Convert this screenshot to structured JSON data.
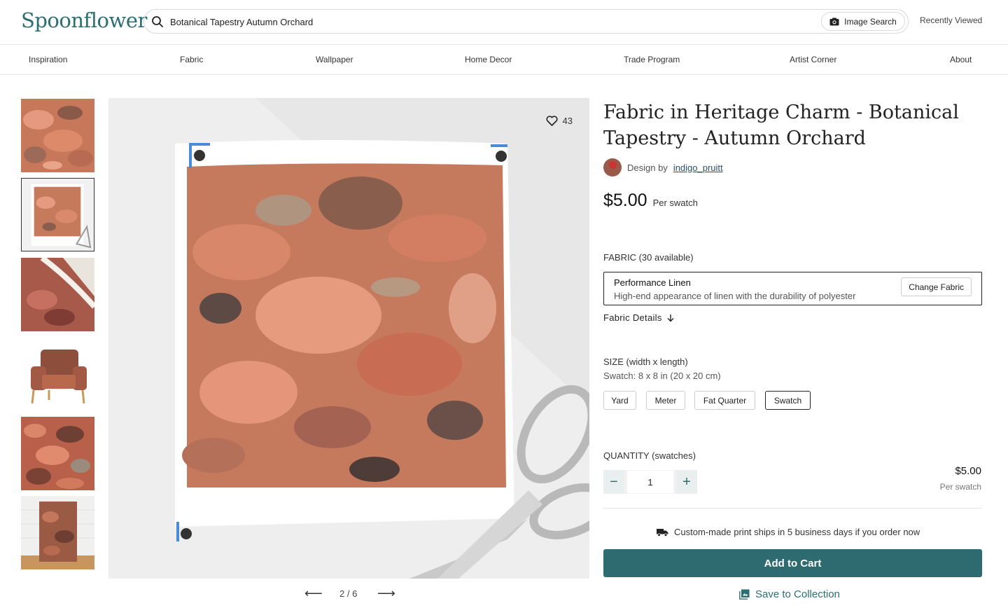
{
  "header": {
    "logo": "Spoonflower",
    "search_value": "Botanical Tapestry Autumn Orchard",
    "image_search_label": "Image Search",
    "recently_viewed": "Recently Viewed"
  },
  "nav": [
    "Inspiration",
    "Fabric",
    "Wallpaper",
    "Home Decor",
    "Trade Program",
    "Artist Corner",
    "About"
  ],
  "gallery": {
    "favorites_count": "43",
    "pager": "2 / 6",
    "prev_icon": "arrow-left-icon",
    "next_icon": "arrow-right-icon"
  },
  "product": {
    "title": "Fabric in Heritage Charm - Botanical Tapestry - Autumn Orchard",
    "design_by_label": "Design by",
    "designer": "indigo_pruitt",
    "price": "$5.00",
    "price_unit": "Per swatch"
  },
  "fabric": {
    "label": "FABRIC (30 available)",
    "name": "Performance Linen",
    "description": "High-end appearance of linen with the durability of polyester",
    "change_label": "Change Fabric",
    "details_label": "Fabric Details"
  },
  "size": {
    "label": "SIZE (width x length)",
    "selected_desc": "Swatch: 8 x 8 in (20 x 20 cm)",
    "options": [
      "Yard",
      "Meter",
      "Fat Quarter",
      "Swatch"
    ],
    "selected": "Swatch"
  },
  "quantity": {
    "label": "QUANTITY (swatches)",
    "value": "1",
    "subtotal": "$5.00",
    "subtotal_unit": "Per swatch"
  },
  "shipping": "Custom-made print ships in 5 business days if you order now",
  "actions": {
    "add_to_cart": "Add to Cart",
    "save_to_collection": "Save to Collection"
  },
  "colors": {
    "brand": "#2b6f73",
    "cart_button": "#2e6b70"
  }
}
